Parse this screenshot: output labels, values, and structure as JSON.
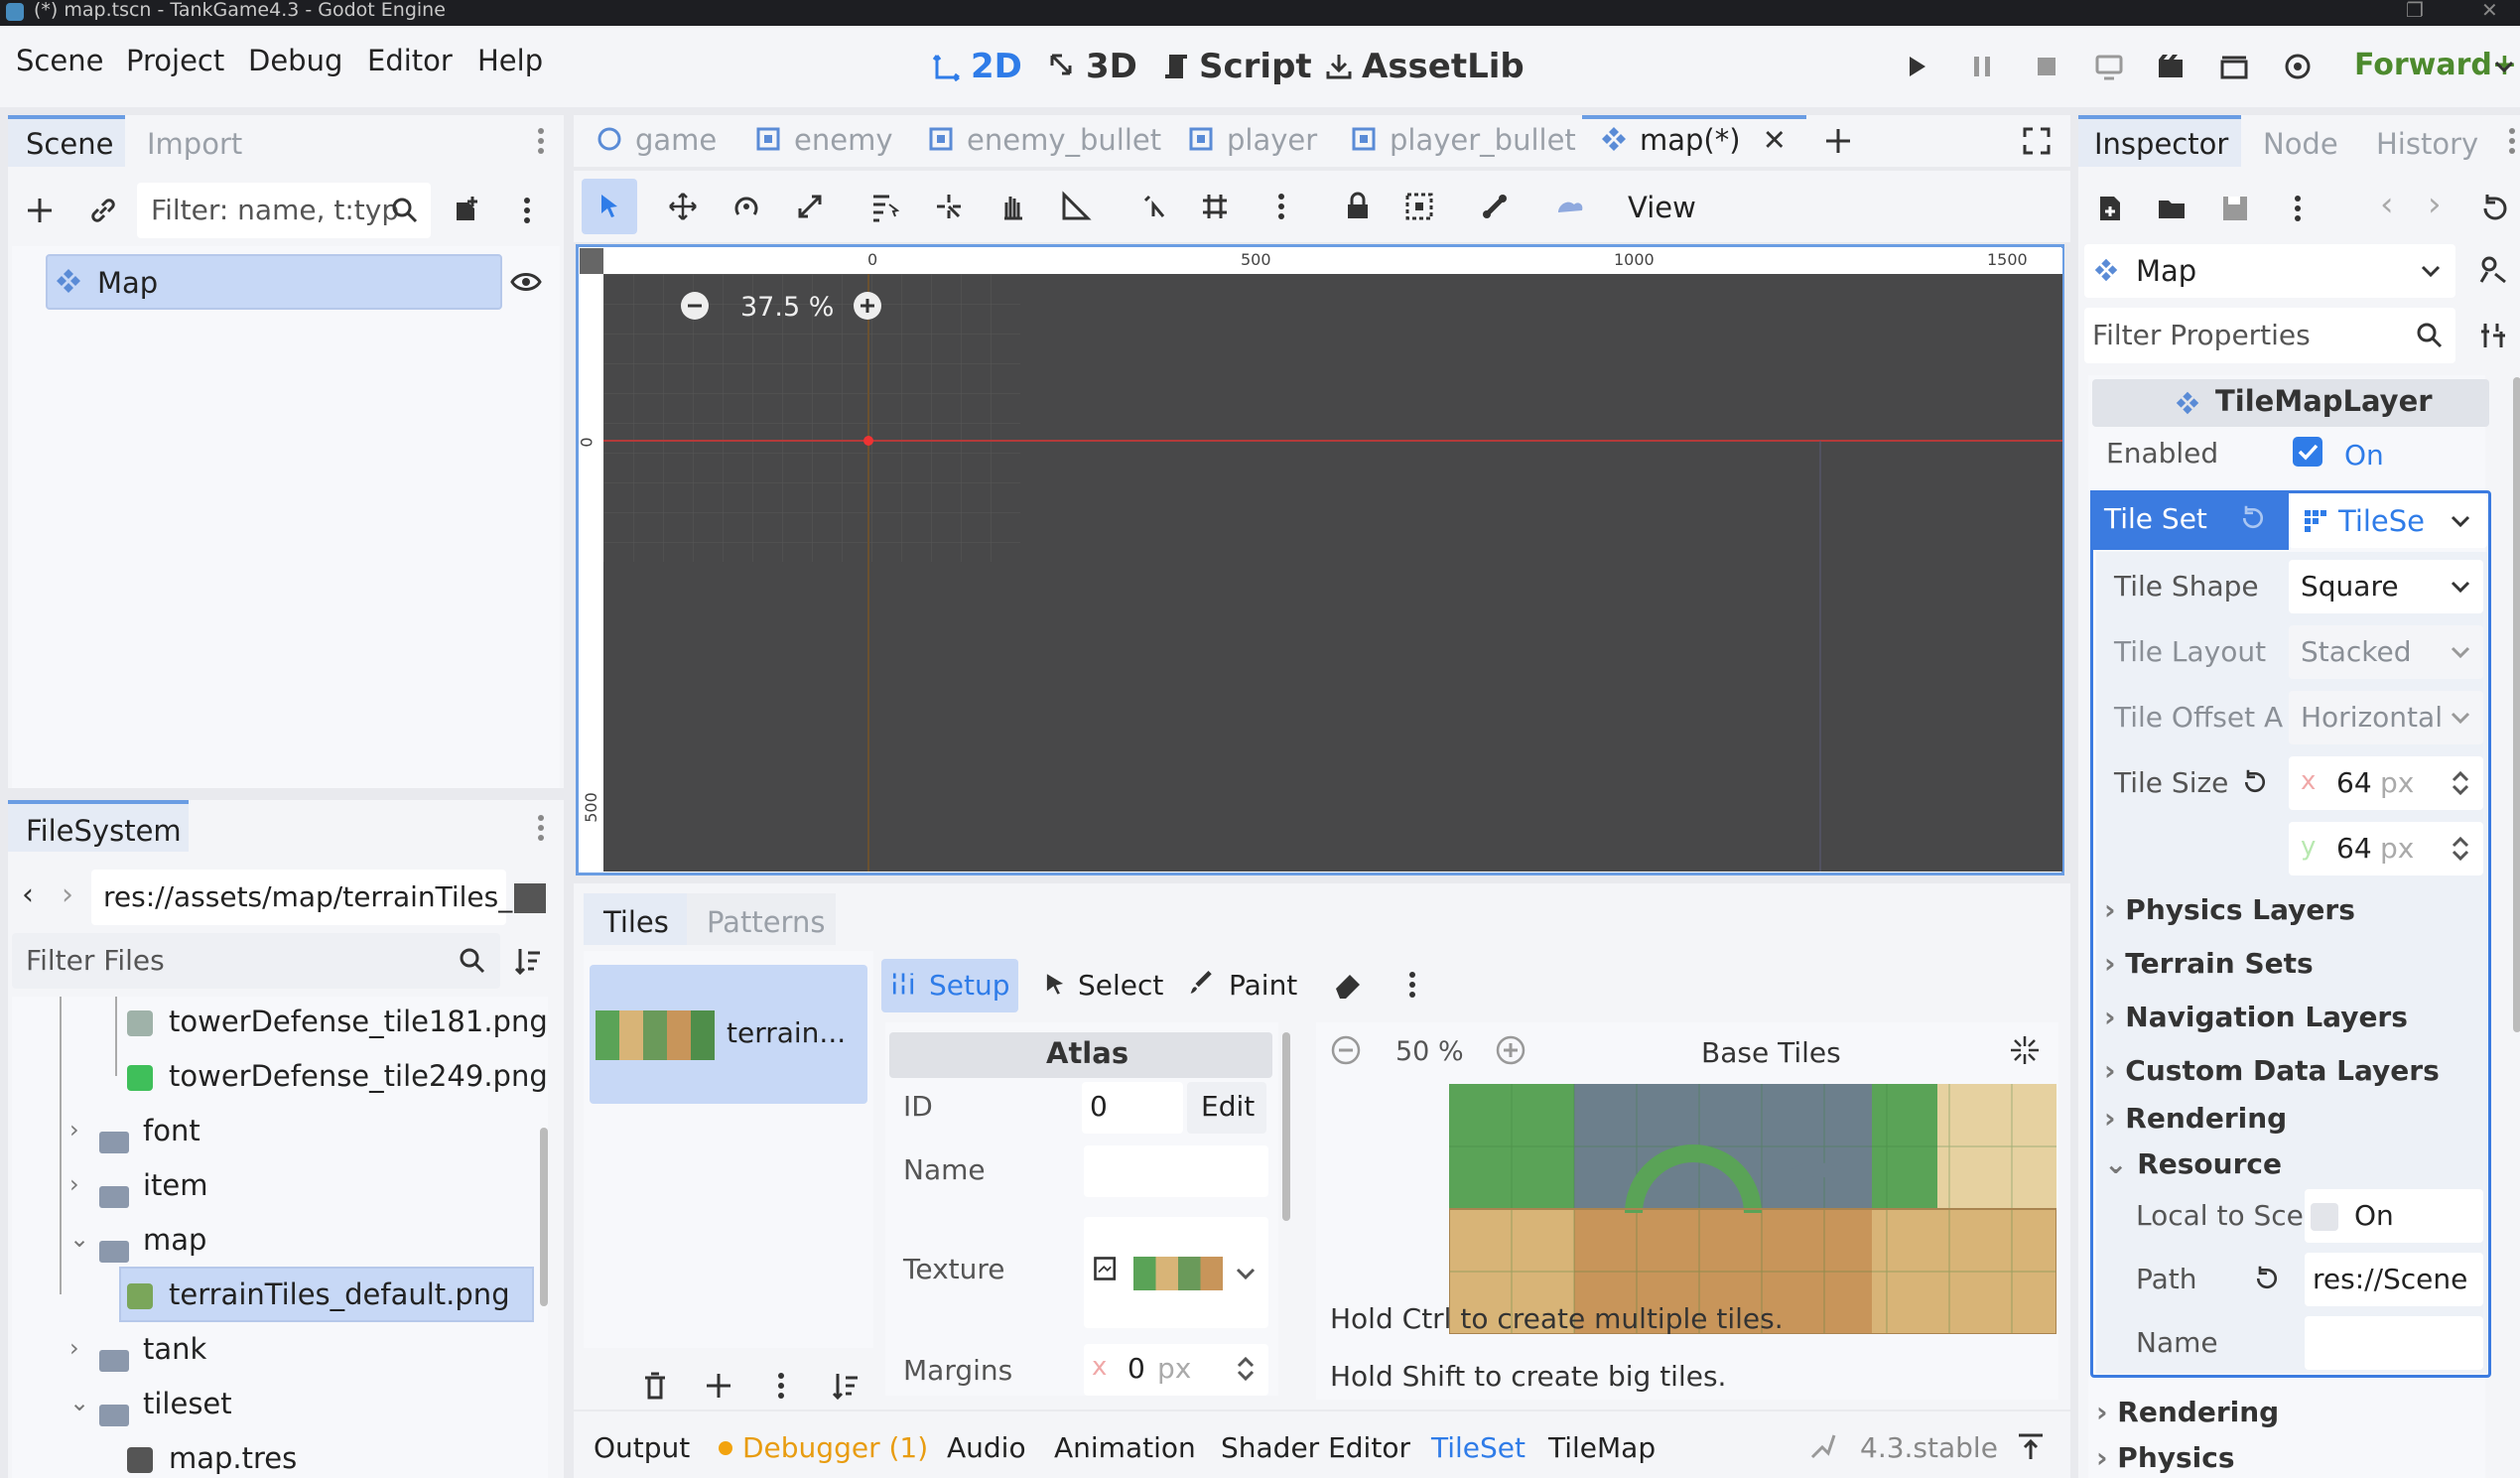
{
  "window": {
    "title": "(*) map.tscn - TankGame4.3 - Godot Engine"
  },
  "menu": [
    "Scene",
    "Project",
    "Debug",
    "Editor",
    "Help"
  ],
  "workspaces": {
    "2d": "2D",
    "3d": "3D",
    "script": "Script",
    "assetlib": "AssetLib"
  },
  "renderer": "Forward+",
  "scene_dock": {
    "tabs": [
      "Scene",
      "Import"
    ],
    "filter_placeholder": "Filter: name, t:typ",
    "root_node": "Map"
  },
  "filesystem": {
    "tab": "FileSystem",
    "path": "res://assets/map/terrainTiles_",
    "filter_placeholder": "Filter Files",
    "items": [
      {
        "label": "towerDefense_tile181.png",
        "kind": "file",
        "depth": 2
      },
      {
        "label": "towerDefense_tile249.png",
        "kind": "file",
        "depth": 2
      },
      {
        "label": "font",
        "kind": "folder",
        "depth": 1
      },
      {
        "label": "item",
        "kind": "folder",
        "depth": 1
      },
      {
        "label": "map",
        "kind": "folder",
        "depth": 1
      },
      {
        "label": "terrainTiles_default.png",
        "kind": "file",
        "depth": 2,
        "selected": true
      },
      {
        "label": "tank",
        "kind": "folder",
        "depth": 1
      },
      {
        "label": "tileset",
        "kind": "folder",
        "depth": 1
      },
      {
        "label": "map.tres",
        "kind": "file",
        "depth": 2
      }
    ]
  },
  "scene_tabs": [
    {
      "label": "game"
    },
    {
      "label": "enemy"
    },
    {
      "label": "enemy_bullet"
    },
    {
      "label": "player"
    },
    {
      "label": "player_bullet"
    },
    {
      "label": "map(*)",
      "active": true
    }
  ],
  "viewport": {
    "zoom": "37.5 %",
    "view_menu": "View",
    "ruler_top": [
      "0",
      "500",
      "1000",
      "1500"
    ],
    "ruler_left": [
      "0",
      "500"
    ]
  },
  "tileset_panel": {
    "tabs": [
      "Tiles",
      "Patterns"
    ],
    "source_name": "terrain...",
    "modes": {
      "setup": "Setup",
      "select": "Select",
      "paint": "Paint"
    },
    "atlas": {
      "header": "Atlas",
      "id_label": "ID",
      "id_value": "0",
      "edit": "Edit",
      "name_label": "Name",
      "texture_label": "Texture",
      "margins_label": "Margins",
      "margins_axis": "x",
      "margins_value": "0",
      "margins_unit": "px"
    },
    "zoom": "50 %",
    "base_tiles": "Base Tiles",
    "hint1": "Hold Ctrl to create multiple tiles.",
    "hint2": "Hold Shift to create big tiles."
  },
  "bottom_bar": {
    "output": "Output",
    "debugger": "Debugger (1)",
    "audio": "Audio",
    "animation": "Animation",
    "shader": "Shader Editor",
    "tileset": "TileSet",
    "tilemap": "TileMap",
    "version": "4.3.stable"
  },
  "inspector": {
    "tabs": [
      "Inspector",
      "Node",
      "History"
    ],
    "object": "Map",
    "filter_placeholder": "Filter Properties",
    "class_name": "TileMapLayer",
    "enabled_label": "Enabled",
    "enabled_value": "On",
    "tileset_label": "Tile Set",
    "tileset_value": "TileSe",
    "tile_shape_label": "Tile Shape",
    "tile_shape_value": "Square",
    "tile_layout_label": "Tile Layout",
    "tile_layout_value": "Stacked",
    "tile_offset_label": "Tile Offset A",
    "tile_offset_value": "Horizontal",
    "tile_size_label": "Tile Size",
    "tile_size_x": "64",
    "tile_size_y": "64",
    "axis_x": "x",
    "axis_y": "y",
    "unit": "px",
    "sections": [
      "Physics Layers",
      "Terrain Sets",
      "Navigation Layers",
      "Custom Data Layers",
      "Rendering",
      "Resource"
    ],
    "local_label": "Local to Sce",
    "local_value": "On",
    "path_label": "Path",
    "path_value": "res://Scene",
    "name_label": "Name",
    "outer_sections": [
      "Rendering",
      "Physics"
    ]
  },
  "colors": {
    "accent": "#2f7ce8",
    "viewport_bg": "#484849",
    "selection": "#c7d8f6",
    "debugger_dot": "#f2a30f"
  }
}
